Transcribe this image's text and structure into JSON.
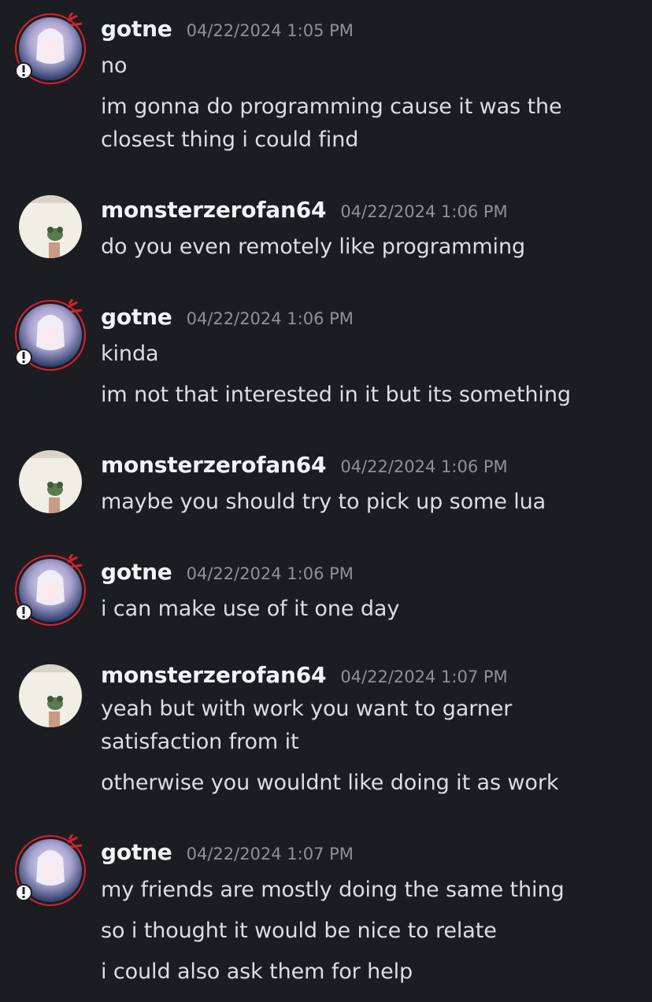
{
  "messages": [
    {
      "user": "gotne",
      "time": "04/22/2024 1:05 PM",
      "lines": [
        "no",
        "im gonna do programming cause it was the",
        "closest thing i could find"
      ]
    },
    {
      "user": "monsterzerofan64",
      "time": "04/22/2024 1:06 PM",
      "lines": [
        "do you even remotely like programming"
      ]
    },
    {
      "user": "gotne",
      "time": "04/22/2024 1:06 PM",
      "lines": [
        "kinda",
        "im not that interested in it but its something"
      ]
    },
    {
      "user": "monsterzerofan64",
      "time": "04/22/2024 1:06 PM",
      "lines": [
        "maybe you should try to pick up some lua"
      ]
    },
    {
      "user": "gotne",
      "time": "04/22/2024 1:06 PM",
      "lines": [
        "i can make use of it one day"
      ]
    },
    {
      "user": "monsterzerofan64",
      "time": "04/22/2024 1:07 PM",
      "lines": [
        "yeah but with work you want to garner",
        "satisfaction from it",
        "otherwise you wouldnt like doing it as work"
      ]
    },
    {
      "user": "gotne",
      "time": "04/22/2024 1:07 PM",
      "lines": [
        "my friends are mostly doing the same thing",
        "so i thought it would be nice to relate",
        "i could also ask them for help"
      ]
    }
  ],
  "colors": {
    "background": "#1c1d22",
    "username": "#f2f3f5",
    "timestamp": "#8e9199",
    "text": "#dcdee2",
    "decoration_red": "#d9212c"
  },
  "icons": {
    "gotne_avatar": "anime-avatar-icon",
    "gotne_badge": "exclamation-badge-icon",
    "monster_avatar": "frog-avatar-icon"
  }
}
